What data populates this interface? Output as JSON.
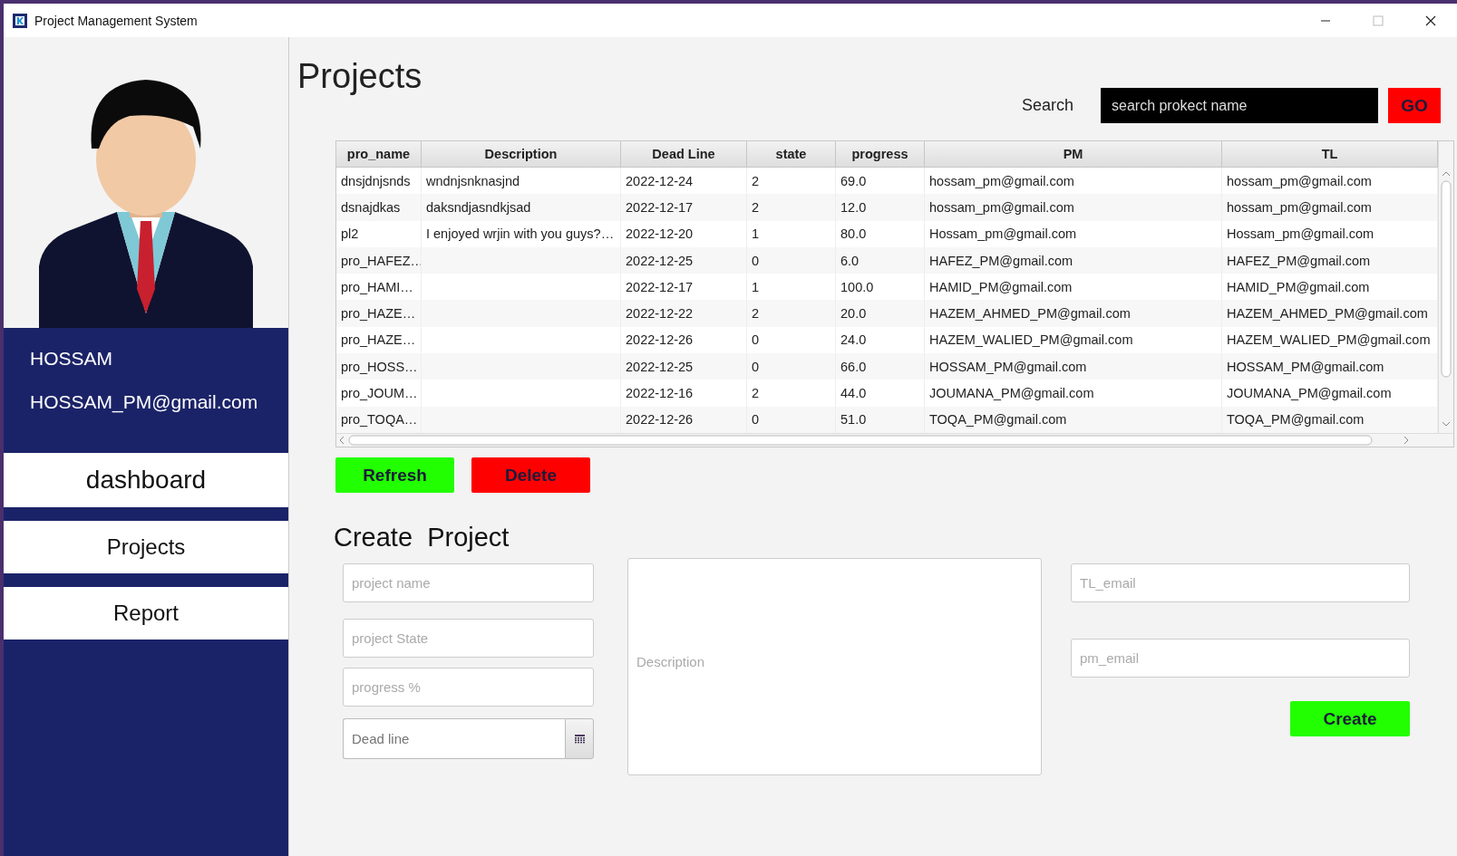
{
  "window": {
    "title": "Project Management System"
  },
  "sidebar": {
    "user_name": "HOSSAM",
    "user_email": "HOSSAM_PM@gmail.com",
    "nav": [
      {
        "label": "dashboard",
        "kind": "large"
      },
      {
        "label": "Projects",
        "kind": "normal"
      },
      {
        "label": "Report",
        "kind": "normal"
      }
    ]
  },
  "page_title": "Projects",
  "search": {
    "label": "Search",
    "value": "search prokect name",
    "button": "GO"
  },
  "table": {
    "columns": [
      "pro_name",
      "Description",
      "Dead Line",
      "state",
      "progress",
      "PM",
      "TL"
    ],
    "rows": [
      {
        "pro_name": "dnsjdnjsnds",
        "description": "wndnjsnknasjnd",
        "dead_line": "2022-12-24",
        "state": "2",
        "progress": "69.0",
        "pm": "hossam_pm@gmail.com",
        "tl": "hossam_pm@gmail.com"
      },
      {
        "pro_name": "dsnajdkas",
        "description": "daksndjasndkjsad",
        "dead_line": "2022-12-17",
        "state": "2",
        "progress": "12.0",
        "pm": "hossam_pm@gmail.com",
        "tl": "hossam_pm@gmail.com"
      },
      {
        "pro_name": "pl2",
        "description": "I enjoyed wrjin with you guys?…",
        "dead_line": "2022-12-20",
        "state": "1",
        "progress": "80.0",
        "pm": "Hossam_pm@gmail.com",
        "tl": "Hossam_pm@gmail.com"
      },
      {
        "pro_name": "pro_HAFEZ…",
        "dead_line": "2022-12-25",
        "state": "0",
        "progress": "6.0",
        "pm": "HAFEZ_PM@gmail.com",
        "tl": "HAFEZ_PM@gmail.com"
      },
      {
        "pro_name": "pro_HAMI…",
        "dead_line": "2022-12-17",
        "state": "1",
        "progress": "100.0",
        "pm": "HAMID_PM@gmail.com",
        "tl": "HAMID_PM@gmail.com"
      },
      {
        "pro_name": "pro_HAZE…",
        "dead_line": "2022-12-22",
        "state": "2",
        "progress": "20.0",
        "pm": "HAZEM_AHMED_PM@gmail.com",
        "tl": "HAZEM_AHMED_PM@gmail.com"
      },
      {
        "pro_name": "pro_HAZE…",
        "dead_line": "2022-12-26",
        "state": "0",
        "progress": "24.0",
        "pm": "HAZEM_WALIED_PM@gmail.com",
        "tl": "HAZEM_WALIED_PM@gmail.com"
      },
      {
        "pro_name": "pro_HOSS…",
        "dead_line": "2022-12-25",
        "state": "0",
        "progress": "66.0",
        "pm": "HOSSAM_PM@gmail.com",
        "tl": "HOSSAM_PM@gmail.com"
      },
      {
        "pro_name": "pro_JOUM…",
        "dead_line": "2022-12-16",
        "state": "2",
        "progress": "44.0",
        "pm": "JOUMANA_PM@gmail.com",
        "tl": "JOUMANA_PM@gmail.com"
      },
      {
        "pro_name": "pro_TOQA…",
        "dead_line": "2022-12-26",
        "state": "0",
        "progress": "51.0",
        "pm": "TOQA_PM@gmail.com",
        "tl": "TOQA_PM@gmail.com"
      }
    ]
  },
  "actions": [
    {
      "label": "Refresh",
      "kind": "refresh"
    },
    {
      "label": "Delete",
      "kind": "delete"
    }
  ],
  "create": {
    "title": "Create  Project",
    "fields": {
      "name": {
        "placeholder": "project name"
      },
      "state": {
        "placeholder": "project State"
      },
      "progress": {
        "placeholder": "progress %"
      },
      "dead_line": {
        "placeholder": "Dead line"
      },
      "description": {
        "placeholder": "Description"
      },
      "tl_email": {
        "placeholder": "TL_email"
      },
      "pm_email": {
        "placeholder": "pm_email"
      }
    },
    "button": "Create"
  }
}
